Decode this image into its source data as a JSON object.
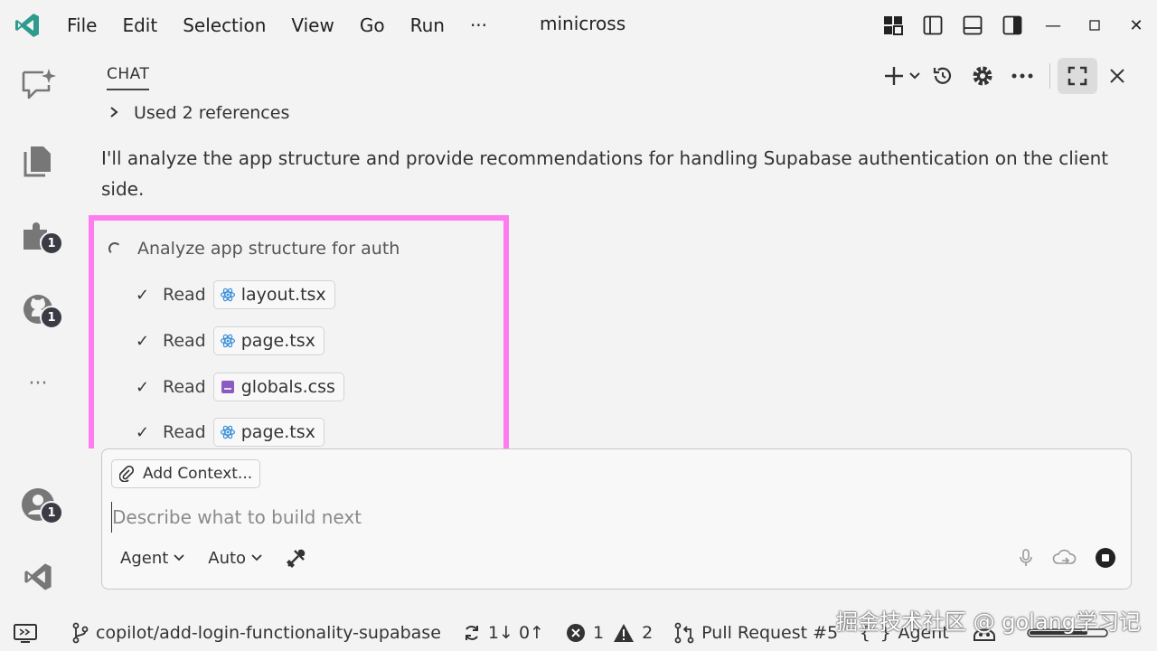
{
  "titlebar": {
    "menu": [
      "File",
      "Edit",
      "Selection",
      "View",
      "Go",
      "Run",
      "···"
    ],
    "window_title": "minicross"
  },
  "activity": {
    "extensions_badge": "1",
    "github_badge": "1",
    "accounts_badge": "1",
    "more": "···"
  },
  "chat": {
    "tab_label": "CHAT",
    "references": "Used 2 references",
    "response": "I'll analyze the app structure and provide recommendations for handling Supabase authentication on the client side.",
    "task_title": "Analyze app structure for auth",
    "read_label": "Read",
    "files": [
      {
        "name": "layout.tsx",
        "kind": "react"
      },
      {
        "name": "page.tsx",
        "kind": "react"
      },
      {
        "name": "globals.css",
        "kind": "css"
      },
      {
        "name": "page.tsx",
        "kind": "react"
      }
    ]
  },
  "input": {
    "add_context": "Add Context...",
    "placeholder": "Describe what to build next",
    "mode": "Agent",
    "model": "Auto"
  },
  "statusbar": {
    "branch": "copilot/add-login-functionality-supabase",
    "sync": "1↓ 0↑",
    "errors": "1",
    "warnings": "2",
    "pull_request": "Pull Request #5",
    "agent": "Agent"
  },
  "watermark": "掘金技术社区 @ golang学习记",
  "colors": {
    "highlight_border": "#ff7bf0",
    "vscode_blue": "#2f80c9",
    "react_blue": "#3a8fd9",
    "css_purple": "#8a5cc2"
  }
}
